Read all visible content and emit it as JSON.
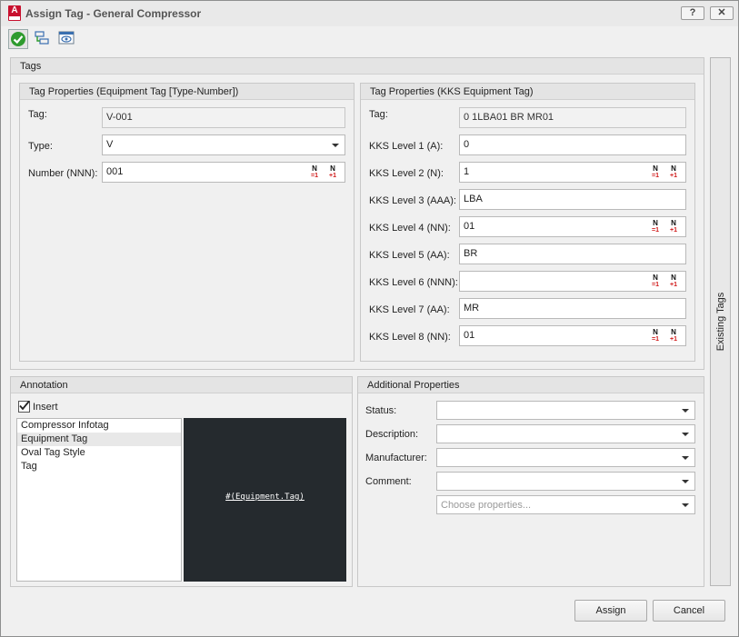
{
  "window": {
    "title": "Assign Tag - General Compressor",
    "help_label": "?",
    "close_label": "✕"
  },
  "icons": {
    "app": "autocad-plant-icon",
    "accept": "checkmark-accept-icon",
    "tag_tool": "tag-assign-icon",
    "view": "view-eye-icon"
  },
  "colors": {
    "accept_green": "#2e9b2e",
    "app_red": "#c8102e",
    "preview_bg": "#252a2e",
    "stepper_red": "#d01818"
  },
  "tags_panel": {
    "title": "Tags"
  },
  "equip_panel": {
    "title": "Tag Properties (Equipment Tag [Type-Number])",
    "tag_label": "Tag:",
    "tag_value": "V-001",
    "type_label": "Type:",
    "type_value": "V",
    "number_label": "Number (NNN):",
    "number_value": "001"
  },
  "stepper": {
    "n": "N",
    "reset": "=1",
    "inc": "+1"
  },
  "kks_panel": {
    "title": "Tag Properties (KKS Equipment Tag)",
    "tag_label": "Tag:",
    "tag_value": "0 1LBA01 BR MR01",
    "levels": [
      {
        "label": "KKS Level 1 (A):",
        "value": "0"
      },
      {
        "label": "KKS Level 2 (N):",
        "value": "1"
      },
      {
        "label": "KKS Level 3 (AAA):",
        "value": "LBA"
      },
      {
        "label": "KKS Level 4 (NN):",
        "value": "01"
      },
      {
        "label": "KKS Level 5 (AA):",
        "value": "BR"
      },
      {
        "label": "KKS Level 6 (NNN):",
        "value": ""
      },
      {
        "label": "KKS Level 7 (AA):",
        "value": "MR"
      },
      {
        "label": "KKS Level 8 (NN):",
        "value": "01"
      }
    ]
  },
  "side_tab": {
    "label": "Existing Tags"
  },
  "annotation": {
    "title": "Annotation",
    "insert_label": "Insert",
    "insert_checked": true,
    "styles": [
      "Compressor Infotag",
      "Equipment Tag",
      "Oval Tag Style",
      "Tag"
    ],
    "selected_style": "Equipment Tag",
    "preview_text": "#(Equipment.Tag)"
  },
  "additional": {
    "title": "Additional Properties",
    "status_label": "Status:",
    "description_label": "Description:",
    "manufacturer_label": "Manufacturer:",
    "comment_label": "Comment:",
    "choose_placeholder": "Choose properties..."
  },
  "buttons": {
    "assign": "Assign",
    "cancel": "Cancel"
  }
}
